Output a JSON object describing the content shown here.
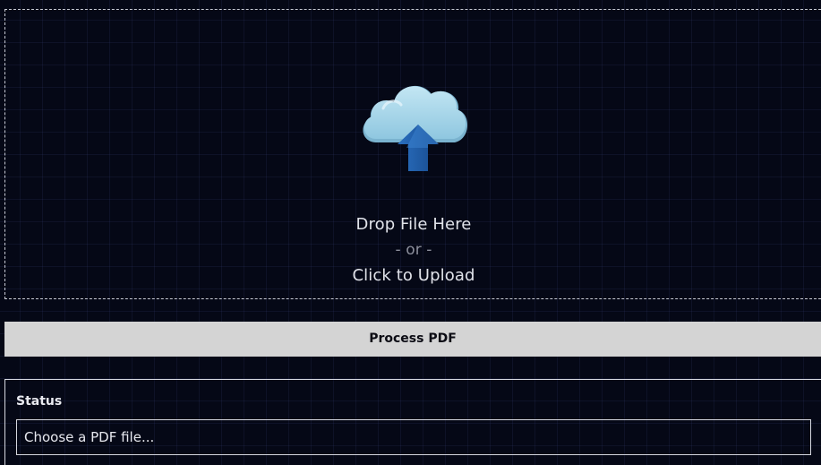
{
  "upload": {
    "icon": "cloud-upload-icon",
    "drop_label": "Drop File Here",
    "or_label": "- or -",
    "click_label": "Click to Upload"
  },
  "actions": {
    "process_label": "Process PDF"
  },
  "status": {
    "label": "Status",
    "value": "Choose a PDF file..."
  },
  "colors": {
    "background": "#050816",
    "button_bg": "#d4d4d4",
    "cloud_light": "#a9d8ea",
    "arrow_blue": "#1f5fad"
  }
}
